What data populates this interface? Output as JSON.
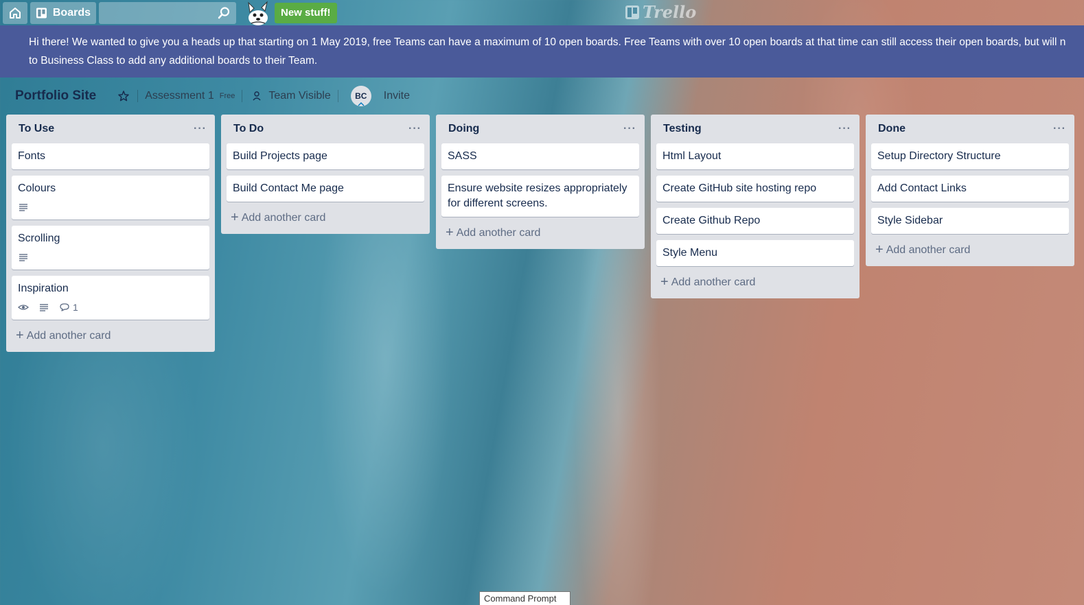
{
  "header": {
    "boards_label": "Boards",
    "new_stuff_label": "New stuff!",
    "logo_text": "Trello"
  },
  "banner": {
    "line1": "Hi there! We wanted to give you a heads up that starting on 1 May 2019, free Teams can have a maximum of 10 open boards. Free Teams with over 10 open boards at that time can still access their open boards, but will n",
    "line2": "to Business Class to add any additional boards to their Team."
  },
  "board": {
    "title": "Portfolio Site",
    "team": "Assessment 1",
    "team_badge": "Free",
    "visibility": "Team Visible",
    "member_initials": "BC",
    "invite_label": "Invite"
  },
  "lists": [
    {
      "title": "To Use",
      "cards": [
        {
          "title": "Fonts"
        },
        {
          "title": "Colours",
          "has_description": true
        },
        {
          "title": "Scrolling",
          "has_description": true
        },
        {
          "title": "Inspiration",
          "watching": true,
          "has_description": true,
          "comments": "1"
        }
      ],
      "add_label": "Add another card"
    },
    {
      "title": "To Do",
      "cards": [
        {
          "title": "Build Projects page"
        },
        {
          "title": "Build Contact Me page"
        }
      ],
      "add_label": "Add another card"
    },
    {
      "title": "Doing",
      "cards": [
        {
          "title": "SASS"
        },
        {
          "title": "Ensure website resizes appropriately for different screens."
        }
      ],
      "add_label": "Add another card"
    },
    {
      "title": "Testing",
      "cards": [
        {
          "title": "Html Layout"
        },
        {
          "title": "Create GitHub site hosting repo"
        },
        {
          "title": "Create Github Repo"
        },
        {
          "title": "Style Menu"
        }
      ],
      "add_label": "Add another card"
    },
    {
      "title": "Done",
      "cards": [
        {
          "title": "Setup Directory Structure"
        },
        {
          "title": "Add Contact Links"
        },
        {
          "title": "Style Sidebar"
        }
      ],
      "add_label": "Add another card"
    }
  ],
  "tooltip": {
    "text": "Command Prompt"
  },
  "colors": {
    "banner_bg": "#4a5a9a",
    "list_bg": "#dfe1e6",
    "new_stuff_bg": "#5aac44"
  }
}
